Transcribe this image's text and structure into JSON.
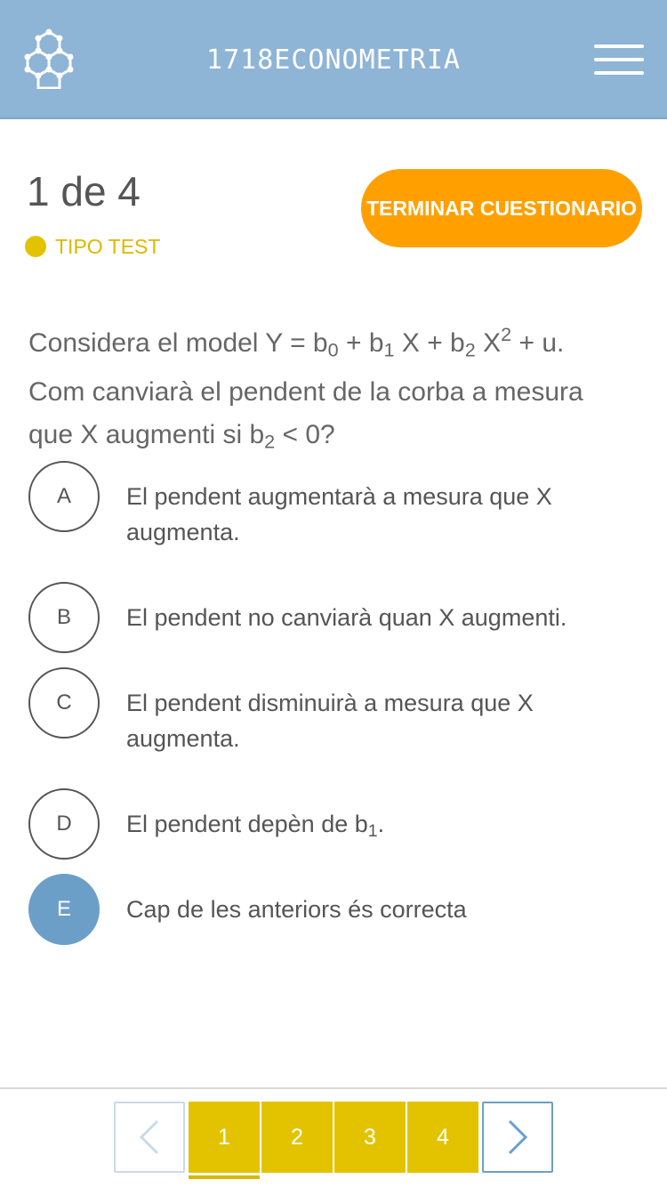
{
  "header": {
    "title": "1718ECONOMETRIA",
    "logo_icon": "hexagon-molecule-icon",
    "menu_icon": "hamburger-menu-icon",
    "background": "#8eb4d6"
  },
  "quiz": {
    "counter": "1 de 4",
    "type_label": "TIPO TEST",
    "type_color": "#e3c300",
    "finish_label": "TERMINAR CUESTIONARIO",
    "finish_color": "#ffa000"
  },
  "question": {
    "line1_prefix": "Considera el model Y = b",
    "sub0": "0",
    "plus1": " + b",
    "sub1": "1",
    "x1": " X + b",
    "sub2": "2",
    "x2": " X",
    "sup2": "2",
    "end1": " + u.",
    "line2": "Com canviarà el pendent de la corba a mesura",
    "line3_prefix": "que X augmenti si b",
    "sub3": "2",
    "line3_suffix": " < 0?"
  },
  "options": [
    {
      "letter": "A",
      "text": "El pendent augmentarà a mesura que X augmenta."
    },
    {
      "letter": "B",
      "text": "El pendent no canviarà quan X augmenti."
    },
    {
      "letter": "C",
      "text": "El pendent disminuirà a mesura que X augmenta."
    },
    {
      "letter": "D",
      "text_prefix": "El pendent depèn de b",
      "text_sub": "1",
      "text_suffix": "."
    },
    {
      "letter": "E",
      "text": "Cap de les anteriors és correcta",
      "selected": true
    }
  ],
  "pagination": {
    "prev_icon": "chevron-left-icon",
    "next_icon": "chevron-right-icon",
    "pages": [
      "1",
      "2",
      "3",
      "4"
    ],
    "current": "1",
    "page_color": "#e3c300"
  }
}
